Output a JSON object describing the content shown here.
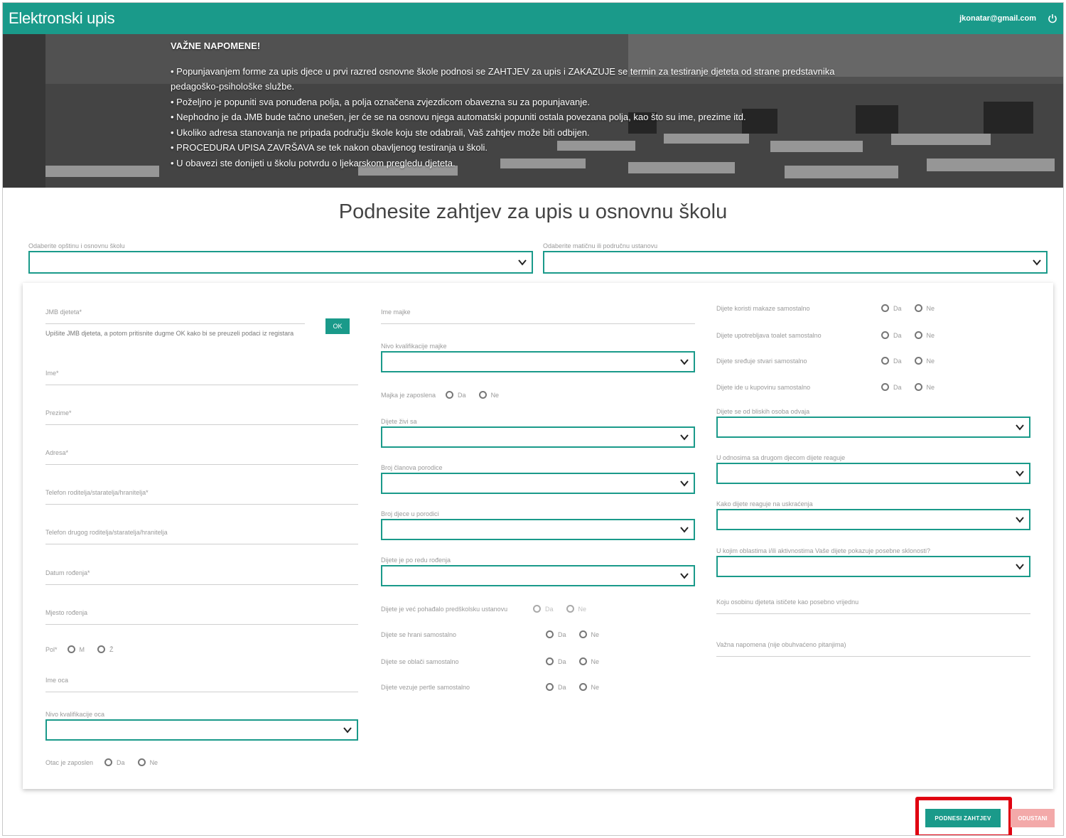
{
  "header": {
    "title": "Elektronski upis",
    "email": "jkonatar@gmail.com",
    "power_icon": "power-icon"
  },
  "notes": {
    "title": "VAŽNE NAPOMENE!",
    "items": [
      "• Popunjavanjem forme za upis djece u prvi razred osnovne škole podnosi se ZAHTJEV za upis i ZAKAZUJE se termin za testiranje djeteta od strane predstavnika pedagoško-psihološke službe.",
      "• Poželjno je popuniti sva ponuđena polja, a polja označena zvjezdicom obavezna su za popunjavanje.",
      "• Nephodno je da JMB bude tačno unešen, jer će se na osnovu njega automatski popuniti ostala povezana polja, kao što su ime, prezime itd.",
      "• Ukoliko adresa stanovanja ne pripada području škole koju ste odabrali, Vaš zahtjev može biti odbijen.",
      "• PROCEDURA UPISA ZAVRŠAVA se tek nakon obavljenog testiranja u školi.",
      "• U obavezi ste donijeti u školu potvrdu o ljekarskom pregledu djeteta."
    ]
  },
  "page_title": "Podnesite zahtjev za upis u osnovnu školu",
  "top_selects": {
    "school_label": "Odaberite opštinu i osnovnu školu",
    "unit_label": "Odaberite matičnu ili područnu ustanovu"
  },
  "col1": {
    "jmb_label": "JMB djeteta*",
    "jmb_helper": "Upišite JMB djeteta, a potom pritisnite dugme OK kako bi se preuzeli podaci iz registara",
    "ok_label": "OK",
    "first_name": "Ime*",
    "last_name": "Prezime*",
    "address": "Adresa*",
    "phone1": "Telefon roditelja/staratelja/hranitelja*",
    "phone2": "Telefon drugog roditelja/staratelja/hranitelja",
    "birth_date": "Datum rođenja*",
    "birth_place": "Mjesto rođenja",
    "gender_label": "Pol*",
    "gender_m": "M",
    "gender_z": "Ž",
    "father_name": "Ime oca",
    "father_qual": "Nivo kvalifikacije oca",
    "father_employed": "Otac je zaposlen",
    "da": "Da",
    "ne": "Ne"
  },
  "col2": {
    "mother_name": "Ime majke",
    "mother_qual": "Nivo kvalifikacije majke",
    "mother_employed": "Majka je zaposlena",
    "lives_with": "Dijete živi sa",
    "family_members": "Broj članova porodice",
    "children_count": "Broj djece u porodici",
    "birth_order": "Dijete je po redu rođenja",
    "preschool": "Dijete je već pohađalo predškolsku ustanovu",
    "eats_alone": "Dijete se hrani samostalno",
    "dresses_alone": "Dijete se oblači samostalno",
    "laces_alone": "Dijete vezuje pertle samostalno"
  },
  "col3": {
    "scissors": "Dijete koristi makaze samostalno",
    "toilet": "Dijete upotrebljava toalet samostalno",
    "tidies": "Dijete sređuje stvari samostalno",
    "shopping": "Dijete ide u kupovinu samostalno",
    "separation": "Dijete se od bliskih osoba odvaja",
    "relations": "U odnosima sa drugom djecom dijete reaguje",
    "frustration": "Kako dijete reaguje na uskraćenja",
    "interests": "U kojim oblastima i/ili aktivnostima Vaše dijete pokazuje posebne sklonosti?",
    "valuable_trait": "Koju osobinu djeteta ističete kao posebno vrijednu",
    "important_note": "Važna napomena (nije obuhvaćeno pitanjima)"
  },
  "buttons": {
    "submit": "PODNESI ZAHTJEV",
    "cancel": "ODUSTANI"
  },
  "colors": {
    "accent": "#1a9a8a",
    "highlight": "#e00010",
    "cancel": "#f3a9a9"
  }
}
